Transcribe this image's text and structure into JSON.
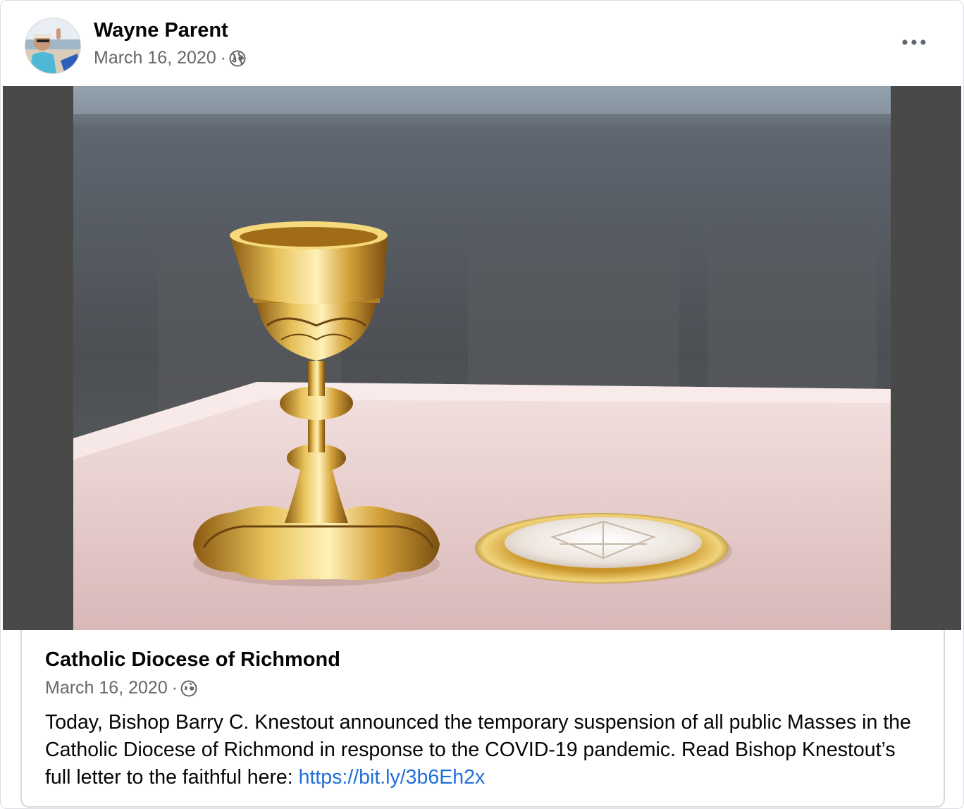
{
  "post": {
    "author": "Wayne Parent",
    "date": "March 16, 2020",
    "separator": "·",
    "privacy_icon": "globe-icon",
    "more_icon": "more-options-icon"
  },
  "media": {
    "description_icon": "chalice-photo"
  },
  "shared": {
    "page_name": "Catholic Diocese of Richmond",
    "date": "March 16, 2020",
    "separator": "·",
    "privacy_icon": "globe-icon",
    "text": "Today, Bishop Barry C. Knestout announced the temporary suspension of all public Masses in the Catholic Diocese of Richmond in response to the COVID-19 pandemic. Read Bishop Knestout’s full letter to the faithful here: ",
    "link": "https://bit.ly/3b6Eh2x"
  },
  "colors": {
    "link": "#216fdb",
    "meta": "#65676b",
    "media_bg": "#494948"
  }
}
